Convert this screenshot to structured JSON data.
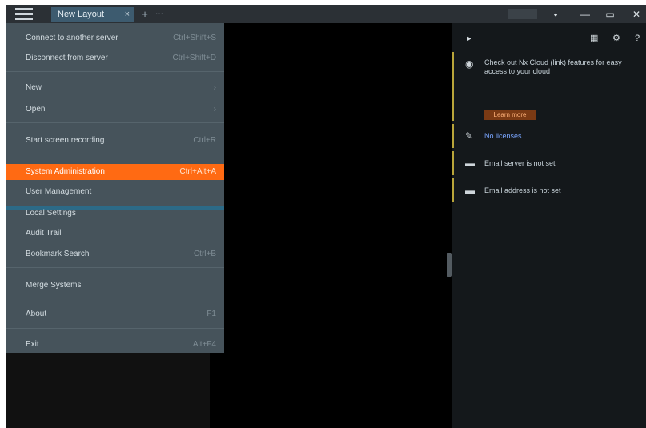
{
  "tabs": [
    {
      "label": "New Layout",
      "close": "×"
    }
  ],
  "topbar": {
    "add_tab": "+",
    "more": "⋯",
    "icons": [
      "user-icon",
      "minimize-icon",
      "maximize-icon",
      "close-icon"
    ]
  },
  "menu": {
    "items": [
      {
        "label": "Connect to another server",
        "shortcut": "Ctrl+Shift+S"
      },
      {
        "label": "Disconnect from server",
        "shortcut": "Ctrl+Shift+D"
      },
      {
        "label": "New",
        "shortcut": "›"
      },
      {
        "label": "Open",
        "shortcut": "›"
      },
      {
        "label": "Start screen recording",
        "shortcut": "Ctrl+R"
      },
      {
        "label": "System Administration",
        "shortcut": "Ctrl+Alt+A",
        "active": true
      },
      {
        "label": "User Management",
        "shortcut": ""
      },
      {
        "label": "Local Settings",
        "shortcut": ""
      },
      {
        "label": "Audit Trail",
        "shortcut": ""
      },
      {
        "label": "Bookmark Search",
        "shortcut": "Ctrl+B"
      },
      {
        "label": "Merge Systems",
        "shortcut": ""
      },
      {
        "label": "About",
        "shortcut": "F1"
      },
      {
        "label": "Exit",
        "shortcut": "Alt+F4"
      }
    ]
  },
  "rpanel": {
    "header": {
      "left": "⯈",
      "icons": [
        "layout-icon",
        "gear-icon",
        "help-icon"
      ]
    },
    "notice": {
      "text": "Check out Nx Cloud (link) features for easy access to your cloud",
      "button": "Learn more"
    },
    "items": [
      {
        "icon": "tag-icon",
        "text": "No licenses",
        "link": true
      },
      {
        "icon": "screen-icon",
        "text": "Email server is not set"
      },
      {
        "icon": "screen-icon",
        "text": "Email address is not set"
      }
    ]
  }
}
